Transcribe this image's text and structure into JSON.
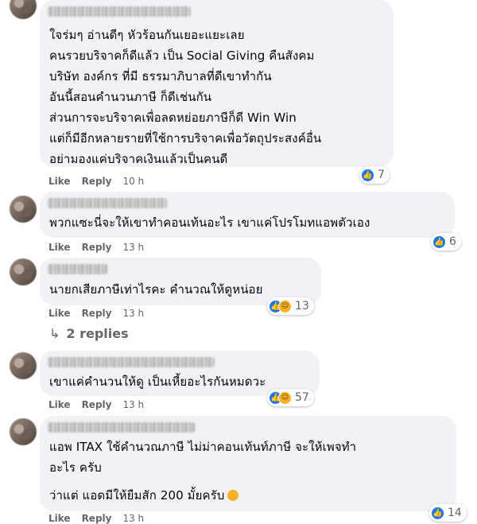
{
  "comments": [
    {
      "lines": [
        "ใจร่มๆ อ่านดีๆ หัวร้อนกันเยอะแยะเลย",
        "คนรวยบริจาคก็ดีแล้ว เป็น Social Giving คืนสังคม",
        "บริษัท องค์กร ที่มี ธรรมาภิบาลที่ดีเขาทำกัน",
        "อันนี้สอนคำนวนภาษี ก็ดีเช่นกัน",
        "ส่วนการจะบริจาคเพื่อลดหย่อยภาษีก็ดี Win Win",
        "แต่ก็มีอีกหลายรายที่ใช้การบริจาคเพื่อวัตถุประสงค์อื่น",
        "อย่ามองแค่บริจาคเงินแล้วเป็นคนดี"
      ],
      "like_label": "Like",
      "reply_label": "Reply",
      "time": "10 h",
      "reaction_count": "7"
    },
    {
      "lines": [
        "พวกแซะนี่จะให้เขาทำคอนเท้นอะไร เขาแค่โปรโมทแอพตัวเอง"
      ],
      "like_label": "Like",
      "reply_label": "Reply",
      "time": "13 h",
      "reaction_count": "6"
    },
    {
      "lines": [
        "นายกเสียภาษีเท่าไรคะ คำนวณให้ดูหน่อย"
      ],
      "like_label": "Like",
      "reply_label": "Reply",
      "time": "13 h",
      "reaction_count": "13",
      "replies_label": "2 replies"
    },
    {
      "lines": [
        "เขาแค่คำนวนให้ดู เป็นเหี้ยอะไรกันหมดวะ"
      ],
      "like_label": "Like",
      "reply_label": "Reply",
      "time": "13 h",
      "reaction_count": "57"
    },
    {
      "lines": [
        "แอพ ITAX ใช้คำนวณภาษี ไม่ม่าคอนเท้นท์ภาษี จะให้เพจทำ",
        "อะไร ครับ",
        "",
        "ว่าแต่ แอดมีให้ยืมสัก 200 มั้ยครับ"
      ],
      "like_label": "Like",
      "reply_label": "Reply",
      "time": "13 h",
      "reaction_count": "14"
    }
  ],
  "icons": {
    "like": "like-icon",
    "haha": "haha-icon",
    "reply_arrow": "reply-arrow-icon",
    "laughing_emoji": "laughing-emoji-icon"
  },
  "colors": {
    "bubble": "#f0f2f5",
    "like_blue": "#1877f2",
    "haha_yellow": "#f7b125",
    "meta_gray": "#65676b"
  }
}
